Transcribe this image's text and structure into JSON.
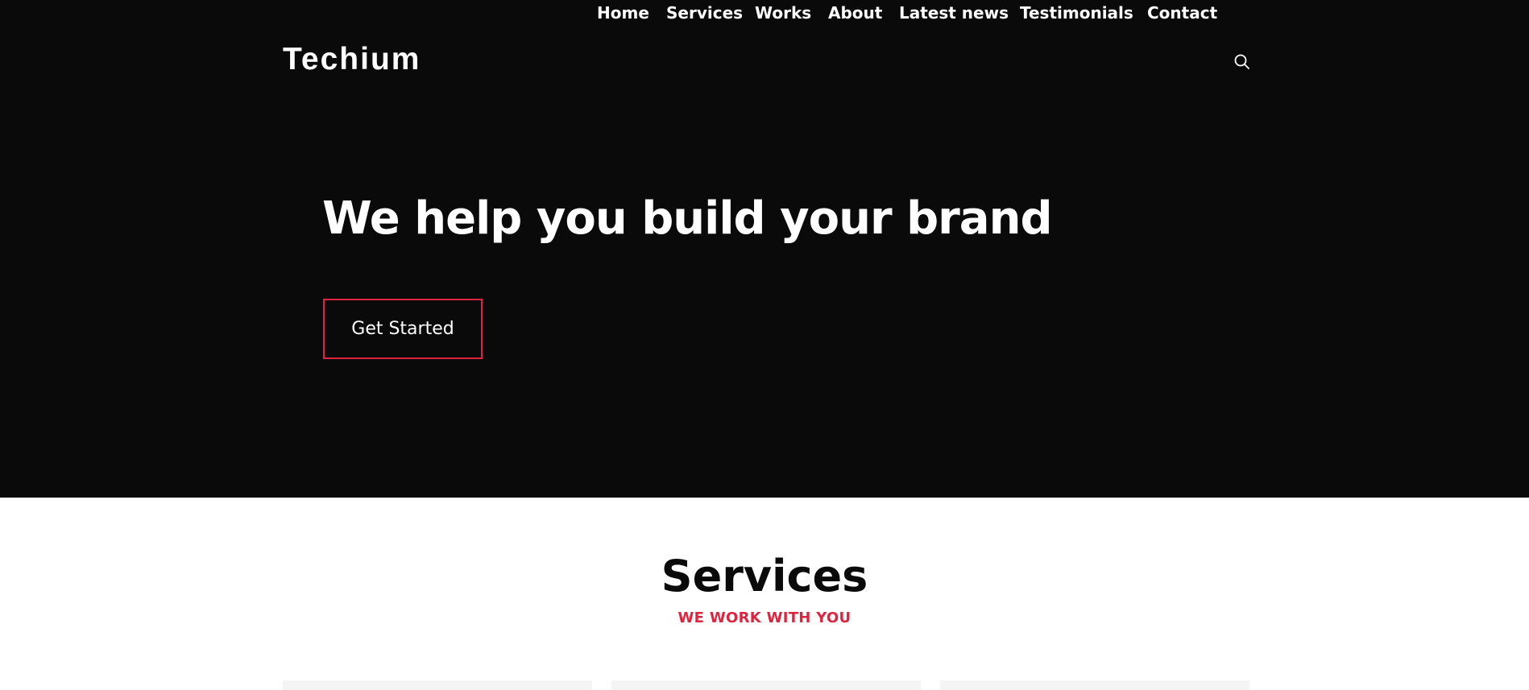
{
  "brand": {
    "logo": "Techium"
  },
  "nav": {
    "items": [
      {
        "label": "Home"
      },
      {
        "label": "Services"
      },
      {
        "label": "Works"
      },
      {
        "label": "About"
      },
      {
        "label": "Latest news"
      },
      {
        "label": "Testimonials"
      },
      {
        "label": "Contact"
      }
    ],
    "search_icon": "search-icon"
  },
  "hero": {
    "title": "We help you build your brand",
    "cta_label": "Get Started"
  },
  "services": {
    "title": "Services",
    "subtitle": "WE WORK WITH YOU"
  },
  "colors": {
    "hero_background": "#0a0a0a",
    "accent": "#e0243f",
    "text_light": "#ffffff",
    "card_background": "#f4f4f4"
  }
}
